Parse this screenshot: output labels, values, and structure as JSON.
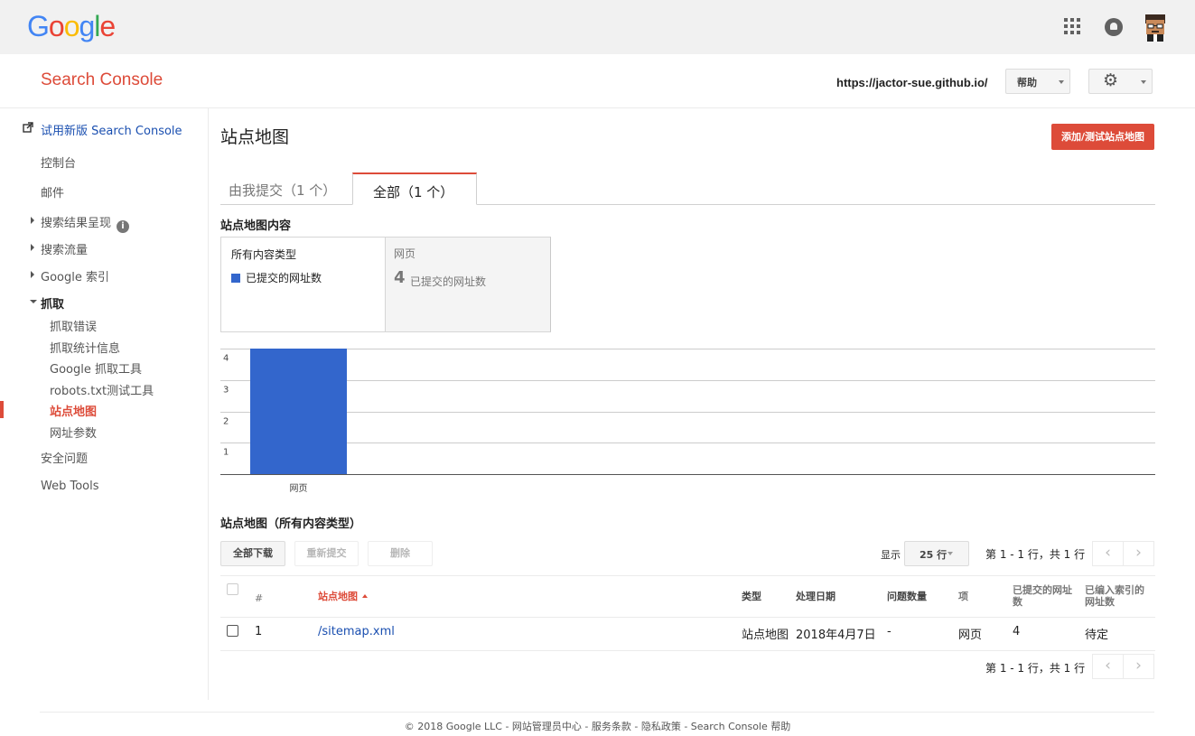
{
  "topbar": {
    "logo_letters": [
      {
        "ch": "G",
        "color": "#4285f4"
      },
      {
        "ch": "o",
        "color": "#ea4335"
      },
      {
        "ch": "o",
        "color": "#fbbc05"
      },
      {
        "ch": "g",
        "color": "#4285f4"
      },
      {
        "ch": "l",
        "color": "#34a853"
      },
      {
        "ch": "e",
        "color": "#ea4335"
      }
    ],
    "icons": [
      "apps-grid-icon",
      "notifications-icon",
      "account-avatar"
    ]
  },
  "header": {
    "product_title": "Search Console",
    "property_url": "https://jactor-sue.github.io/",
    "help_label": "帮助",
    "settings_icon": "gear-icon"
  },
  "sidebar": {
    "try_new": "试用新版 Search Console",
    "dashboard": "控制台",
    "messages": "邮件",
    "search_appearance": "搜索结果呈现",
    "search_traffic": "搜索流量",
    "google_index": "Google 索引",
    "crawl": "抓取",
    "crawl_errors": "抓取错误",
    "crawl_stats": "抓取统计信息",
    "fetch_as_google": "Google 抓取工具",
    "robots_tester": "robots.txt测试工具",
    "sitemaps": "站点地图",
    "url_params": "网址参数",
    "security_issues": "安全问题",
    "web_tools": "Web Tools"
  },
  "main": {
    "title": "站点地图",
    "add_test_button": "添加/测试站点地图",
    "tabs": [
      {
        "label": "由我提交（1 个）",
        "active": false
      },
      {
        "label": "全部（1 个）",
        "active": true
      }
    ],
    "content_heading": "站点地图内容",
    "filter_all": {
      "title": "所有内容类型",
      "legend": "已提交的网址数",
      "legend_color": "#3366cc"
    },
    "filter_web": {
      "title": "网页",
      "count": "4",
      "label": "已提交的网址数"
    },
    "table_heading": "站点地图（所有内容类型）",
    "download_all": "全部下载",
    "resubmit": "重新提交",
    "delete": "删除",
    "show_label": "显示",
    "rows_option": "25 行",
    "pager_text": "第 1 - 1 行，共 1 行",
    "prev_icon": "‹",
    "next_icon": "›"
  },
  "table": {
    "headers": {
      "index": "#",
      "sitemap": "站点地图",
      "type": "类型",
      "processed": "处理日期",
      "issues": "问题数量",
      "items": "项",
      "submitted": "已提交的网址数",
      "indexed": "已编入索引的网址数"
    },
    "rows": [
      {
        "index": "1",
        "sitemap": "/sitemap.xml",
        "type": "站点地图",
        "processed": "2018年4月7日",
        "issues": "-",
        "items": "网页",
        "submitted": "4",
        "indexed": "待定"
      }
    ]
  },
  "chart_data": {
    "type": "bar",
    "categories": [
      "网页"
    ],
    "values": [
      4
    ],
    "ylim": [
      0,
      4
    ],
    "yticks": [
      "1",
      "2",
      "3",
      "4"
    ],
    "bar_color": "#3366cc",
    "grid": true
  },
  "footer": {
    "text": "© 2018 Google LLC - 网站管理员中心 - 服务条款 - 隐私政策 - Search Console 帮助"
  }
}
